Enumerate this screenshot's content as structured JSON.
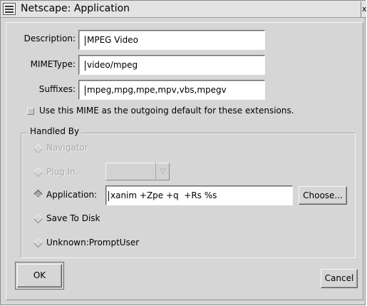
{
  "window": {
    "title": "Netscape: Application",
    "close_glyph": "x"
  },
  "form": {
    "description_label": "Description:",
    "description_value": "MPEG Video",
    "mimetype_label": "MIMEType:",
    "mimetype_value": "video/mpeg",
    "suffixes_label": "Suffixes:",
    "suffixes_value": "mpeg,mpg,mpe,mpv,vbs,mpegv",
    "default_checkbox_label": "Use this MIME as the outgoing default for these extensions.",
    "default_checked": false
  },
  "handled_by": {
    "title": "Handled By",
    "navigator_label": "Navigator",
    "plugin_label": "Plug In.",
    "plugin_select_value": "",
    "application_label": "Application:",
    "application_value": "xanim +Zpe +q  +Rs %s",
    "choose_label": "Choose...",
    "save_to_disk_label": "Save To Disk",
    "unknown_label": "Unknown:PromptUser",
    "selected": "application"
  },
  "buttons": {
    "ok_label": "OK",
    "cancel_label": "Cancel"
  },
  "colors": {
    "background": "#d6d6d6",
    "field": "#ffffff",
    "disabled_text": "#a8a8a8"
  }
}
